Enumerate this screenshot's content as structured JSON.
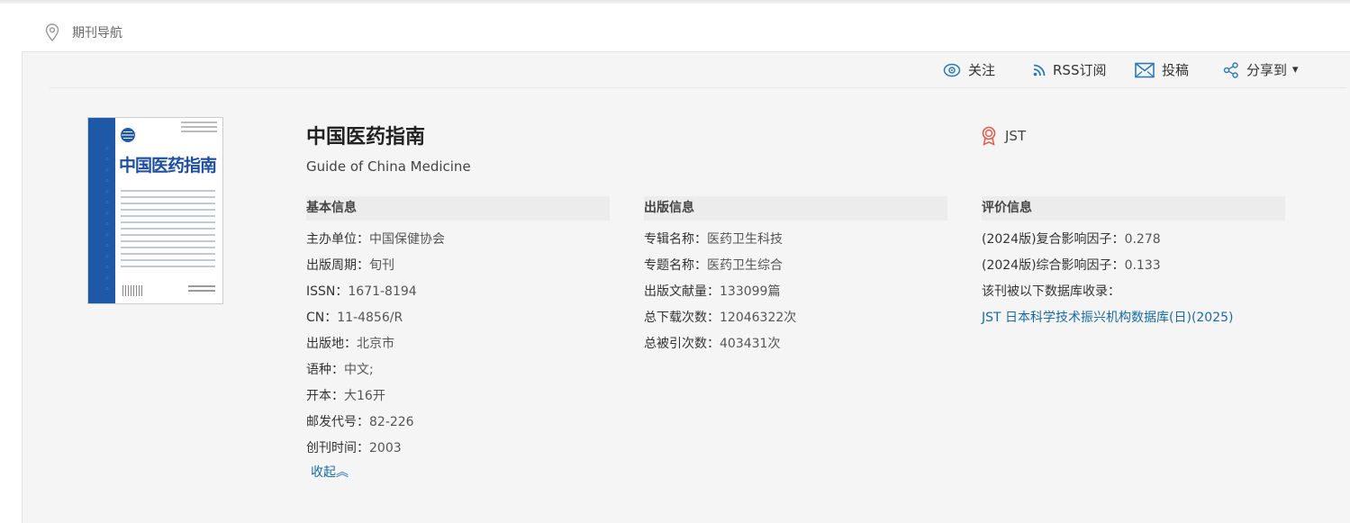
{
  "breadcrumb": {
    "label": "期刊导航"
  },
  "toolbar": {
    "follow": "关注",
    "rss": "RSS订阅",
    "submit": "投稿",
    "share": "分享到",
    "share_caret": "▾"
  },
  "journal": {
    "cover_title": "中国医药指南",
    "title": "中国医药指南",
    "subtitle": "Guide of China Medicine",
    "badge": "JST"
  },
  "sections": {
    "basic": {
      "heading": "基本信息",
      "rows": [
        {
          "label": "主办单位：",
          "value": "中国保健协会"
        },
        {
          "label": "出版周期：",
          "value": "旬刊"
        },
        {
          "label": "ISSN：",
          "value": "1671-8194"
        },
        {
          "label": "CN：",
          "value": "11-4856/R"
        },
        {
          "label": "出版地：",
          "value": "北京市"
        },
        {
          "label": "语种：",
          "value": "中文;"
        },
        {
          "label": "开本：",
          "value": "大16开"
        },
        {
          "label": "邮发代号：",
          "value": "82-226"
        },
        {
          "label": "创刊时间：",
          "value": "2003"
        }
      ],
      "collapse": "收起︽"
    },
    "publish": {
      "heading": "出版信息",
      "rows": [
        {
          "label": "专辑名称：",
          "value": "医药卫生科技"
        },
        {
          "label": "专题名称：",
          "value": "医药卫生综合"
        },
        {
          "label": "出版文献量：",
          "value": "133099篇"
        },
        {
          "label": "总下载次数：",
          "value": "12046322次"
        },
        {
          "label": "总被引次数：",
          "value": "403431次"
        }
      ]
    },
    "evaluation": {
      "heading": "评价信息",
      "rows": [
        {
          "label": "(2024版)复合影响因子：",
          "value": "0.278"
        },
        {
          "label": "(2024版)综合影响因子：",
          "value": "0.133"
        },
        {
          "label": "该刊被以下数据库收录：",
          "value": ""
        }
      ],
      "database": "JST 日本科学技术振兴机构数据库(日)(2025)"
    }
  },
  "colors": {
    "accent": "#1a6aa0",
    "icon_blue": "#2a7ab8",
    "badge_red": "#e05a4a",
    "cover_blue": "#1e59a8"
  }
}
